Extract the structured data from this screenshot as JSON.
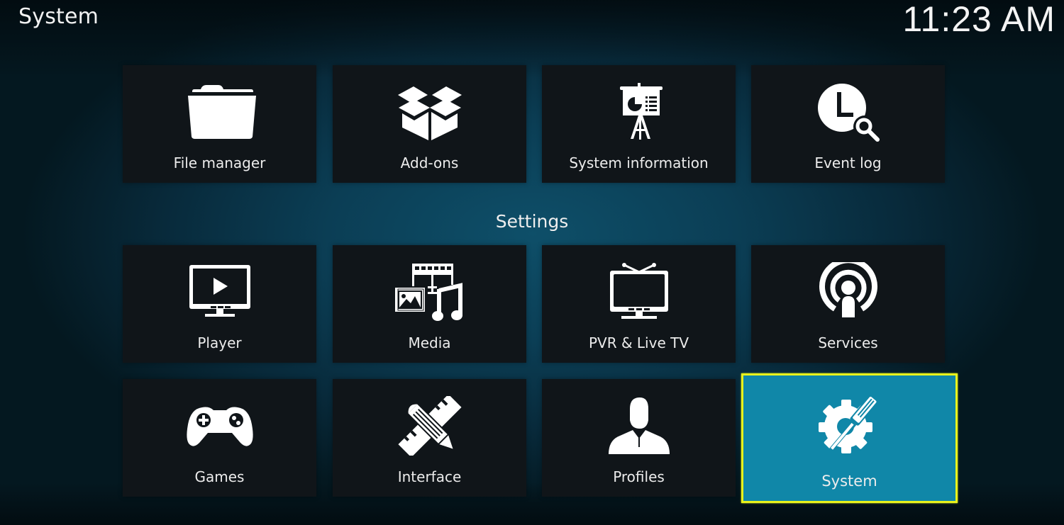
{
  "header": {
    "title": "System",
    "clock": "11:23 AM"
  },
  "top_row": [
    {
      "label": "File manager",
      "icon": "folder-icon"
    },
    {
      "label": "Add-ons",
      "icon": "open-box-icon"
    },
    {
      "label": "System information",
      "icon": "presentation-board-icon"
    },
    {
      "label": "Event log",
      "icon": "clock-search-icon"
    }
  ],
  "settings": {
    "title": "Settings",
    "items": [
      {
        "label": "Player",
        "icon": "monitor-play-icon"
      },
      {
        "label": "Media",
        "icon": "media-collection-icon"
      },
      {
        "label": "PVR & Live TV",
        "icon": "tv-antenna-icon"
      },
      {
        "label": "Services",
        "icon": "broadcast-person-icon"
      },
      {
        "label": "Games",
        "icon": "gamepad-icon"
      },
      {
        "label": "Interface",
        "icon": "ruler-pencil-icon"
      },
      {
        "label": "Profiles",
        "icon": "user-profile-icon"
      },
      {
        "label": "System",
        "icon": "gear-screwdriver-icon",
        "focused": true
      }
    ]
  },
  "colors": {
    "focus_fill": "#1087a8",
    "focus_border": "#e8f21c",
    "tile_bg": "#101519"
  }
}
